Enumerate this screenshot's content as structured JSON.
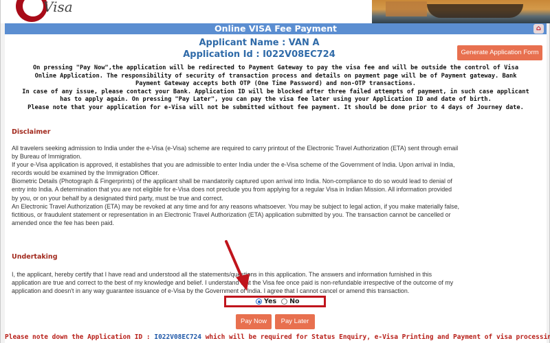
{
  "header": {
    "logo_text": "Visa",
    "page_title": "Online VISA Fee Payment"
  },
  "applicant": {
    "name_line": "Applicant Name : VAN A",
    "id_line": "Application Id : I022V08EC724",
    "generate_button": "Generate Application Form"
  },
  "notice": {
    "lines": [
      "On pressing \"Pay Now\",the application will be redirected to Payment Gateway to pay the visa fee and will be outside the control of Visa",
      "Online Application. The responsibility of security of transaction process and details on payment page will be of Payment gateway. Bank",
      "Payment Gateway accepts both OTP (One Time Password) and non-OTP transactions.",
      "In case of any issue, please contact your Bank. Application ID will be blocked after three failed attempts of payment, in such case applicant",
      "has to apply again. On pressing \"Pay Later\", you can pay the visa fee later using your Application ID and date of birth.",
      "Please note that your application for e-Visa will not be submitted without fee payment. It should be done prior to 4 days of Journey date."
    ]
  },
  "disclaimer": {
    "title": "Disclaimer",
    "lines": [
      "All travelers seeking admission to India under the e-Visa (e-Visa) scheme are required to carry printout of the Electronic Travel Authorization (ETA) sent through email",
      "by Bureau of Immigration.",
      "If your e-Visa application is approved, it establishes that you are admissible to enter India under the e-Visa scheme of the Government of India. Upon arrival in India,",
      "records would be examined by the Immigration Officer.",
      "Biometric Details (Photograph & Fingerprints) of the applicant shall be mandatorily captured upon arrival into India. Non-compliance to do so would lead to denial of",
      "entry into India. A determination that you are not eligible for e-Visa does not preclude you from applying for a regular Visa in Indian Mission. All information provided",
      "by you, or on your behalf by a designated third party, must be true and correct.",
      "An Electronic Travel Authorization (ETA) may be revoked at any time and for any reasons whatsoever. You may be subject to legal action, if you make materially false,",
      "fictitious, or fraudulent statement or representation in an Electronic Travel Authorization (ETA) application submitted by you. The transaction cannot be cancelled or",
      "amended once the fee has been paid."
    ]
  },
  "undertaking": {
    "title": "Undertaking",
    "lines": [
      "I, the applicant, hereby certify that I have read and understood all the statements/questions in this application. The answers and information furnished in this",
      "application are true and correct to the best of my knowledge and belief. I understand that the Visa fee once paid is non-refundable irrespective of the outcome of my",
      "application and doesn't in any way guarantee issuance of e-Visa by the Government of India. I agree that I cannot cancel or amend this transaction."
    ],
    "yes_label": "Yes",
    "no_label": "No",
    "selected": "Yes"
  },
  "actions": {
    "pay_now": "Pay Now",
    "pay_later": "Pay Later"
  },
  "footer": {
    "prefix": "Please note down the Application ID : ",
    "app_id": "I022V08EC724",
    "suffix": " which will be required for Status Enquiry, e-Visa Printing and Payment of visa processing fee."
  },
  "colors": {
    "title_bar": "#5b8ed1",
    "accent_button": "#e8704f",
    "section_title": "#a22a1e",
    "annotation_red": "#c0141c"
  }
}
